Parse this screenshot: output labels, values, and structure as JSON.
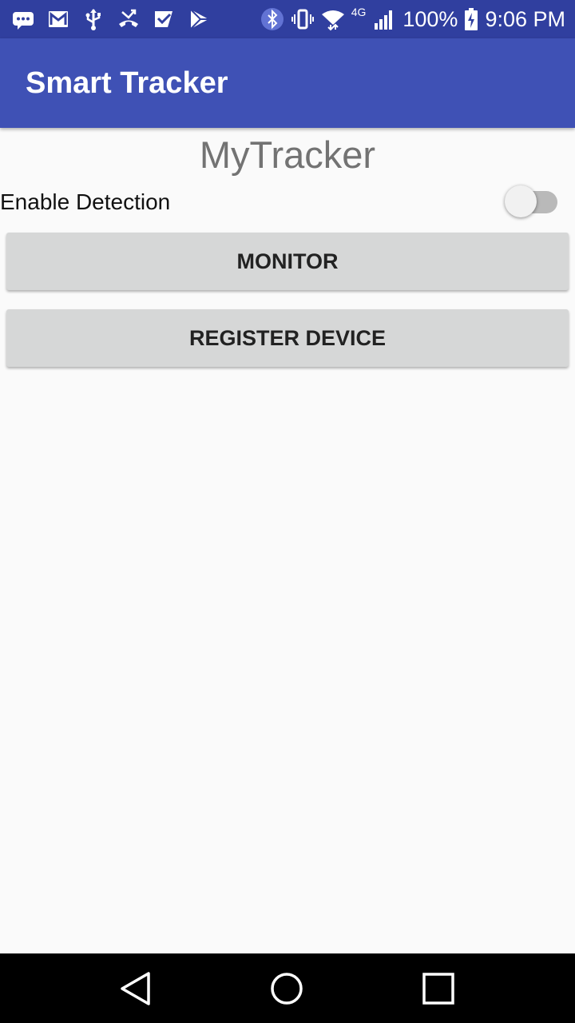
{
  "status_bar": {
    "left_icons": [
      "chat-icon",
      "gmail-icon",
      "usb-icon",
      "missed-call-icon",
      "checkmark-icon",
      "play-store-icon"
    ],
    "right_icons": [
      "bluetooth-icon",
      "vibrate-icon",
      "wifi-icon",
      "cellular-signal-icon",
      "battery-icon"
    ],
    "network_label": "4G",
    "battery_percent": "100%",
    "time": "9:06 PM"
  },
  "app_bar": {
    "title": "Smart Tracker"
  },
  "main": {
    "heading": "MyTracker",
    "detection": {
      "label": "Enable Detection",
      "enabled": false
    },
    "buttons": {
      "monitor": "MONITOR",
      "register": "REGISTER DEVICE"
    }
  },
  "nav_bar": {
    "icons": [
      "back-icon",
      "home-icon",
      "recents-icon"
    ]
  },
  "colors": {
    "status_bar": "#303f9f",
    "app_bar": "#3f51b5",
    "background": "#fafafa",
    "button": "#d6d7d7",
    "switch_track": "#b9b9b9"
  }
}
